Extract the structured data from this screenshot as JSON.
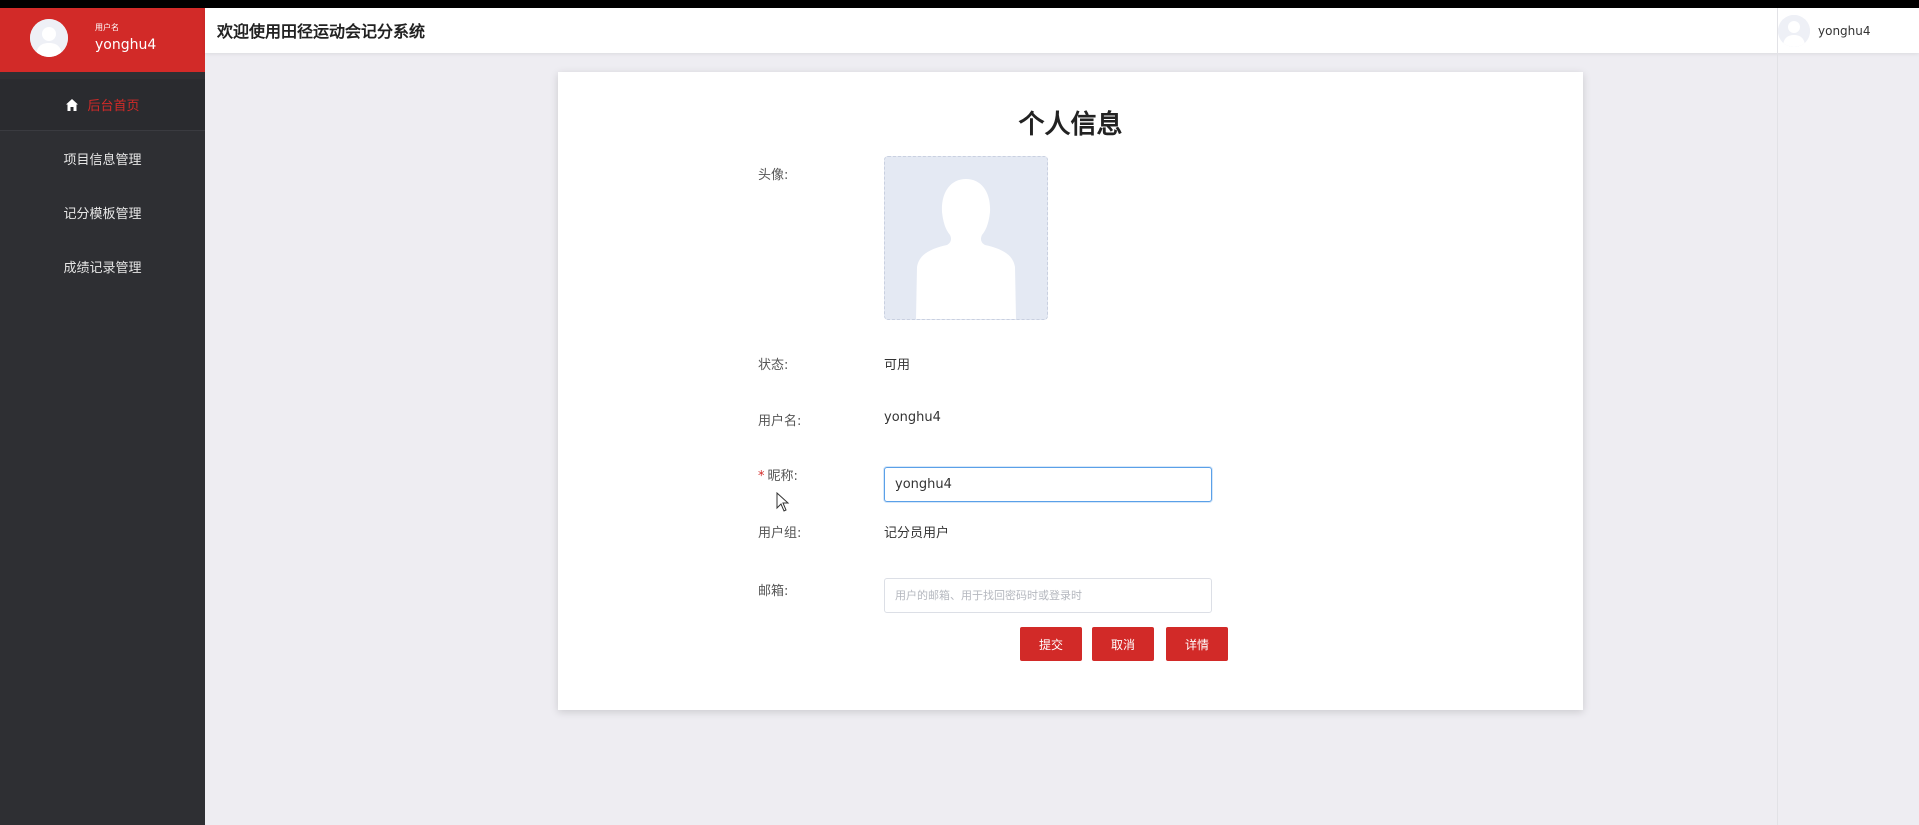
{
  "sidebar": {
    "user_label": "用户名",
    "user_name": "yonghu4",
    "items": [
      {
        "label": "后台首页",
        "active": true,
        "icon": "home-icon"
      },
      {
        "label": "项目信息管理"
      },
      {
        "label": "记分模板管理"
      },
      {
        "label": "成绩记录管理"
      }
    ]
  },
  "header": {
    "title": "欢迎使用田径运动会记分系统",
    "username": "yonghu4"
  },
  "form": {
    "title": "个人信息",
    "avatar_label": "头像:",
    "status_label": "状态:",
    "status_value": "可用",
    "username_label": "用户名:",
    "username_value": "yonghu4",
    "nickname_label": "昵称:",
    "nickname_value": "yonghu4",
    "group_label": "用户组:",
    "group_value": "记分员用户",
    "email_label": "邮箱:",
    "email_value": "",
    "email_placeholder": "用户的邮箱、用于找回密码时或登录时",
    "submit_label": "提交",
    "cancel_label": "取消",
    "details_label": "详情"
  },
  "colors": {
    "accent": "#d22a28",
    "sidebar_bg": "#2e2f33",
    "page_bg": "#eeedf2"
  }
}
